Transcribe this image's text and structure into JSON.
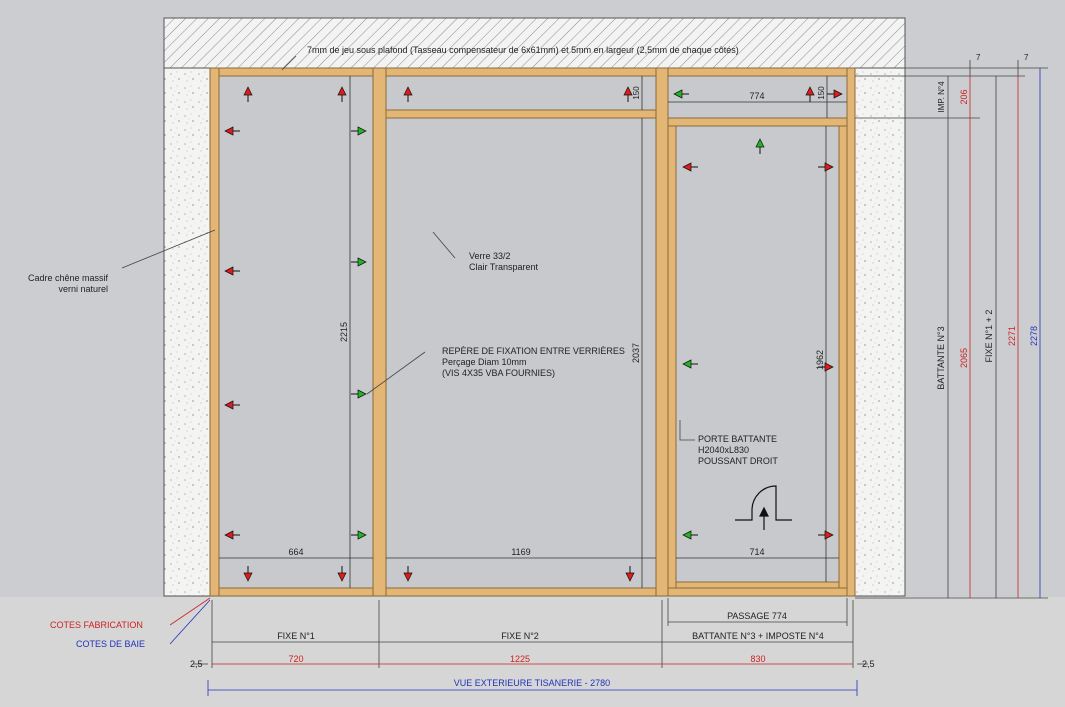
{
  "notes": {
    "ceiling": "7mm de jeu sous plafond (Tasseau compensateur de 6x61mm) et 5mm en largeur (2,5mm de chaque côtés)",
    "frame_line1": "Cadre chêne massif",
    "frame_line2": "verni naturel",
    "glass_line1": "Verre 33/2",
    "glass_line2": "Clair Transparent",
    "fixing_line1": "REPÈRE DE FIXATION ENTRE VERRIÈRES",
    "fixing_line2": "Perçage Diam 10mm",
    "fixing_line3": "(VIS 4X35 VBA FOURNIES)",
    "door_line1": "PORTE BATTANTE",
    "door_line2": "H2040xL830",
    "door_line3": "POUSSANT DROIT"
  },
  "legend": {
    "fabrication": "COTES FABRICATION",
    "bay": "COTES DE BAIE"
  },
  "inner_dims": {
    "w_fixe1": "664",
    "w_fixe2": "1169",
    "w_door": "714",
    "w_imposte": "774",
    "h_fixe1": "2215",
    "h_fixe2": "2037",
    "h_door": "1962",
    "h_transom_left": "150",
    "h_transom_right": "150"
  },
  "bottom": {
    "passage": "PASSAGE 774",
    "label1": "FIXE N°1",
    "label2": "FIXE N°2",
    "label3": "BATTANTE N°3 + IMPOSTE N°4",
    "fab1": "720",
    "fab2": "1225",
    "fab3": "830",
    "gap_left": "2,5",
    "gap_right": "2,5",
    "total": "VUE EXTERIEURE TISANERIE - 2780"
  },
  "right": {
    "imp_label": "IMP. N°4",
    "imp_value": "206",
    "battante_label": "BATTANTE N°3",
    "battante_value": "2065",
    "fixe_label": "FIXE N°1 + 2",
    "fixe_value": "2271",
    "bay_value": "2278",
    "gap1": "7",
    "gap2": "7"
  },
  "colors": {
    "wood": "#e3b676",
    "glass": "#c7c9cd",
    "wall_bg": "#f4f4f2",
    "red_dim": "#cc2222",
    "blue_dim": "#2233bb",
    "arrow_red": "#e01b1b",
    "arrow_green": "#22b522"
  }
}
